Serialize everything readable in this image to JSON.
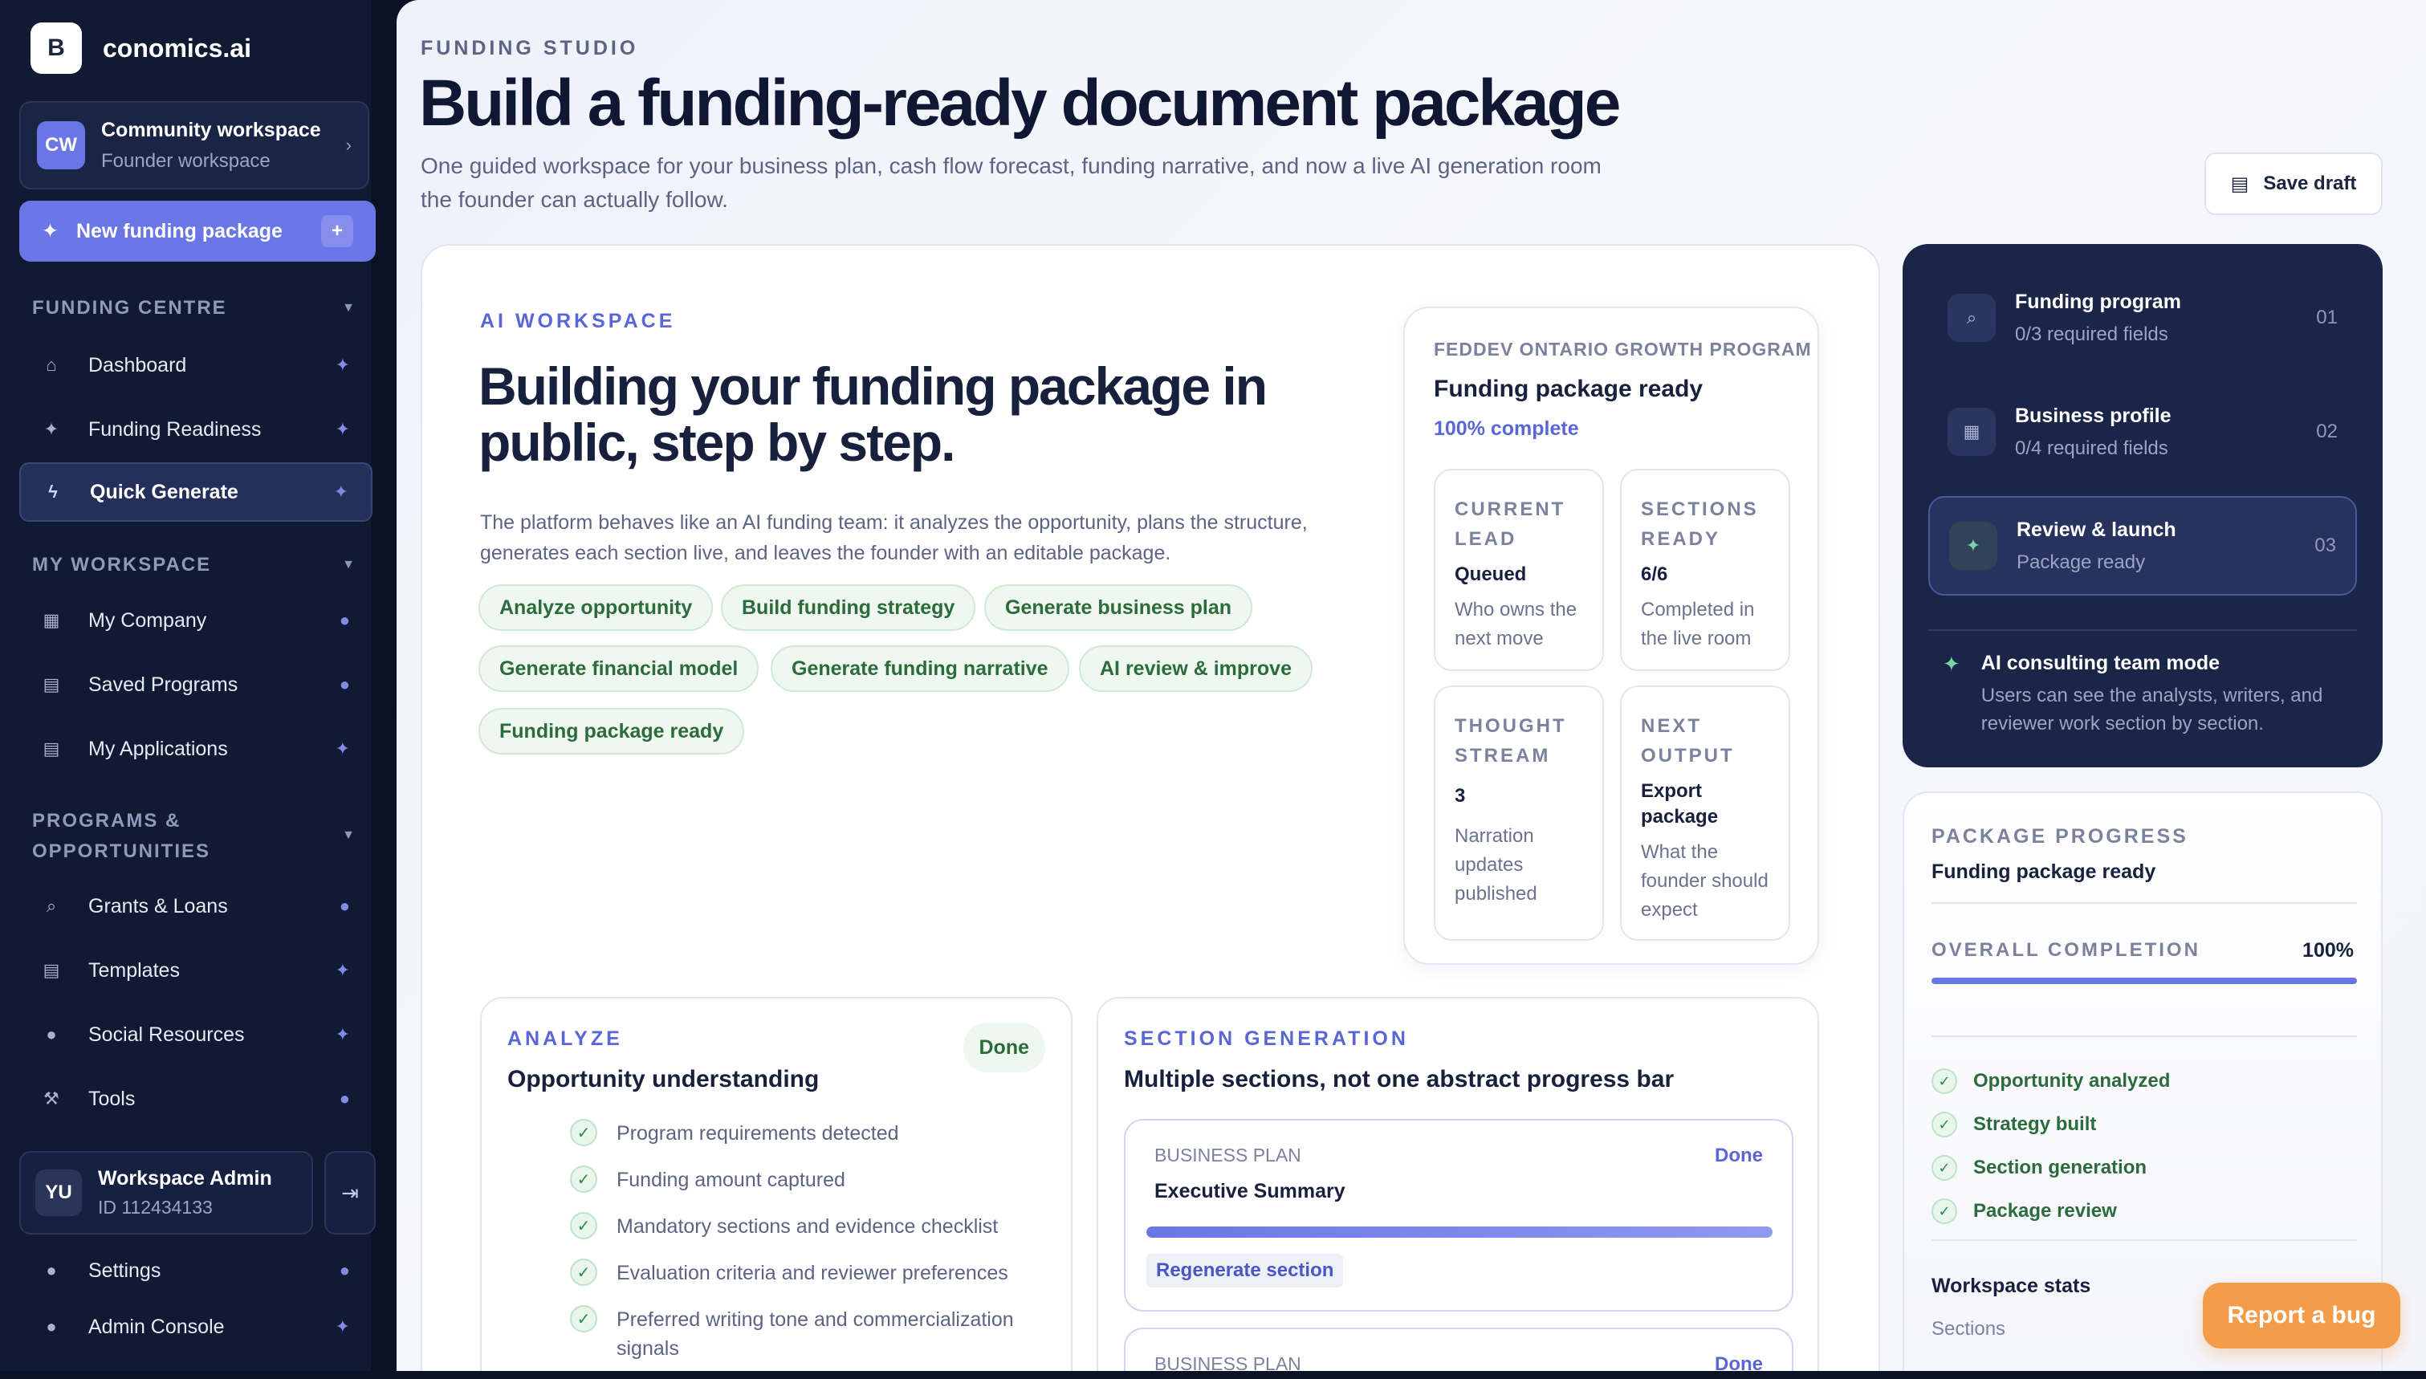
{
  "brand": {
    "logo_letter": "B",
    "name": "conomics.ai"
  },
  "workspace": {
    "avatar": "CW",
    "title": "Community workspace",
    "subtitle": "Founder workspace"
  },
  "new_package": {
    "label": "New funding package",
    "plus": "+"
  },
  "sidebar": {
    "funding_centre": {
      "heading": "FUNDING CENTRE",
      "items": [
        {
          "label": "Dashboard"
        },
        {
          "label": "Funding Readiness"
        },
        {
          "label": "Quick Generate"
        }
      ]
    },
    "my_workspace": {
      "heading": "MY WORKSPACE",
      "items": [
        {
          "label": "My Company"
        },
        {
          "label": "Saved Programs"
        },
        {
          "label": "My Applications"
        }
      ]
    },
    "programs": {
      "heading_line1": "PROGRAMS &",
      "heading_line2": "OPPORTUNITIES",
      "items": [
        {
          "label": "Grants & Loans"
        },
        {
          "label": "Templates"
        },
        {
          "label": "Social Resources"
        },
        {
          "label": "Tools"
        }
      ]
    },
    "admin": {
      "avatar": "YU",
      "name": "Workspace Admin",
      "id": "ID 112434133"
    },
    "footer_items": [
      {
        "label": "Settings"
      },
      {
        "label": "Admin Console"
      }
    ]
  },
  "header": {
    "eyebrow": "FUNDING STUDIO",
    "title": "Build a funding-ready document package",
    "subtitle": "One guided workspace for your business plan, cash flow forecast, funding narrative, and now a live AI generation room the founder can actually follow.",
    "save_label": "Save draft"
  },
  "ai_workspace": {
    "eyebrow": "AI WORKSPACE",
    "headline": "Building your funding package in public, step by step.",
    "description": "The platform behaves like an AI funding team: it analyzes the opportunity, plans the structure, generates each section live, and leaves the founder with an editable package.",
    "pills": [
      "Analyze opportunity",
      "Build funding strategy",
      "Generate business plan",
      "Generate financial model",
      "Generate funding narrative",
      "AI review & improve",
      "Funding package ready"
    ]
  },
  "program_card": {
    "eyebrow": "FEDDEV ONTARIO GROWTH PROGRAM",
    "title": "Funding package ready",
    "percent": "100% complete",
    "minis": [
      {
        "label": "CURRENT LEAD",
        "value": "Queued",
        "desc": "Who owns the next move"
      },
      {
        "label": "SECTIONS READY",
        "value": "6/6",
        "desc": "Completed in the live room"
      },
      {
        "label": "THOUGHT STREAM",
        "value": "3",
        "desc": "Narration updates published"
      },
      {
        "label": "NEXT OUTPUT",
        "value": "Export package",
        "desc": "What the founder should expect"
      }
    ]
  },
  "analyze": {
    "eyebrow": "ANALYZE",
    "title": "Opportunity understanding",
    "badge": "Done",
    "items": [
      "Program requirements detected",
      "Funding amount captured",
      "Mandatory sections and evidence checklist",
      "Evaluation criteria and reviewer preferences",
      "Preferred writing tone and commercialization signals"
    ]
  },
  "section_generation": {
    "eyebrow": "SECTION GENERATION",
    "title": "Multiple sections, not one abstract progress bar",
    "items": [
      {
        "label": "BUSINESS PLAN",
        "title": "Executive Summary",
        "status": "Done",
        "progress": 100,
        "action": "Regenerate section"
      },
      {
        "label": "BUSINESS PLAN",
        "status": "Done"
      }
    ]
  },
  "steps": {
    "items": [
      {
        "title": "Funding program",
        "sub": "0/3 required fields",
        "num": "01"
      },
      {
        "title": "Business profile",
        "sub": "0/4 required fields",
        "num": "02"
      },
      {
        "title": "Review & launch",
        "sub": "Package ready",
        "num": "03"
      }
    ],
    "mode_title": "AI consulting team mode",
    "mode_desc": "Users can see the analysts, writers, and reviewer work section by section."
  },
  "package_progress": {
    "eyebrow": "PACKAGE PROGRESS",
    "title": "Funding package ready",
    "overall_label": "OVERALL COMPLETION",
    "overall_value": "100%",
    "overall_percent": 100,
    "checks": [
      "Opportunity analyzed",
      "Strategy built",
      "Section generation",
      "Package review"
    ],
    "stats_title": "Workspace stats",
    "sections_label": "Sections"
  },
  "bug_button": {
    "label": "Report a bug"
  },
  "colors": {
    "accent": "#6b76e6",
    "sidebar_bg": "#111a33",
    "success": "#2c6b3b",
    "bug": "#f39c4a"
  }
}
